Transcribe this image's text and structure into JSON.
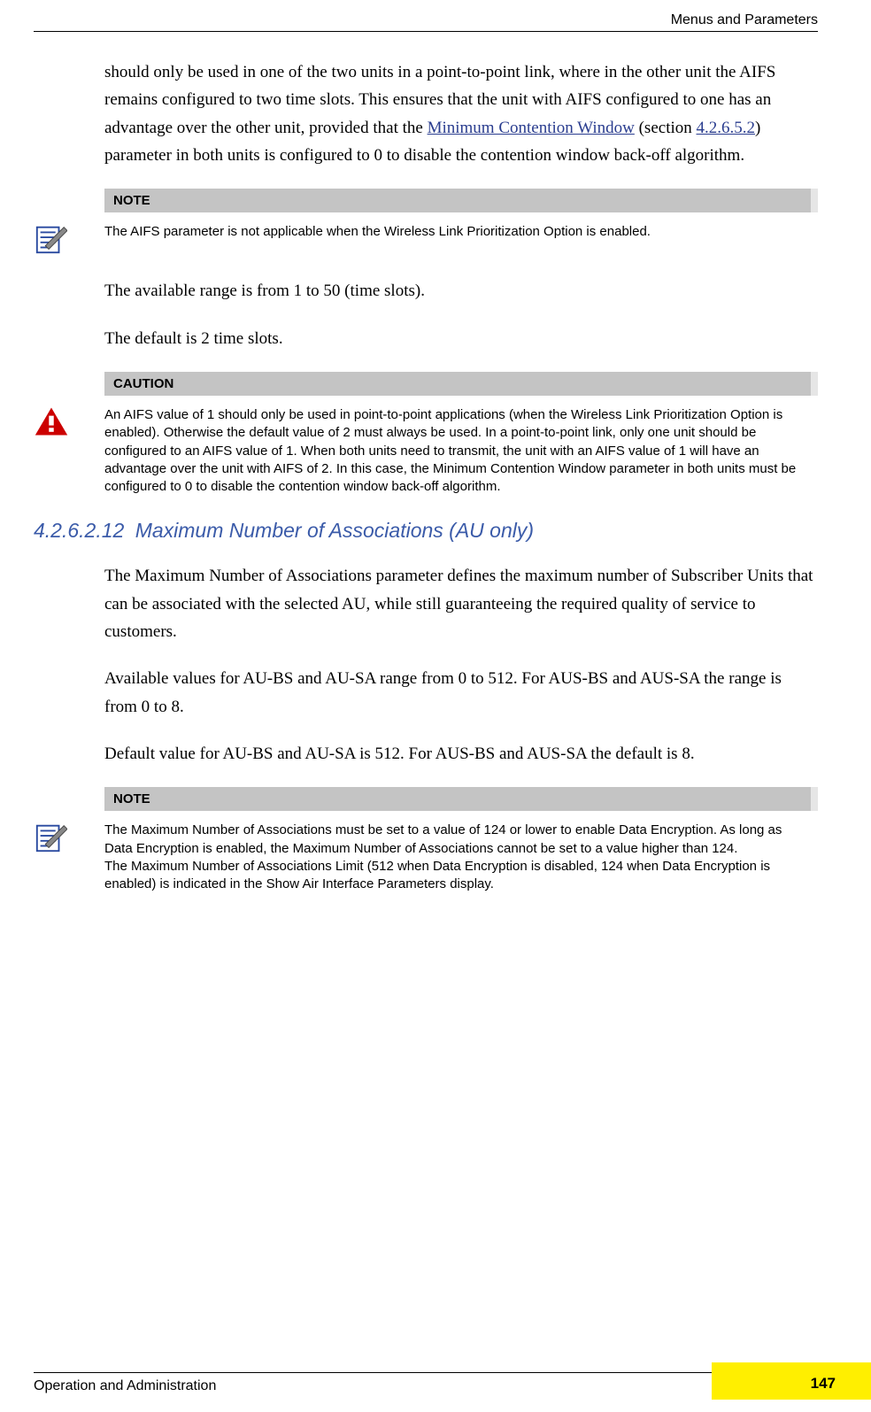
{
  "header": {
    "section": "Menus and Parameters"
  },
  "intro": {
    "para1_a": "should only be used in one of the two units in a point-to-point link, where in the other unit the AIFS remains configured to two time slots. This ensures that the unit with AIFS configured to one has an advantage over the other unit, provided that the ",
    "link1": "Minimum Contention Window",
    "para1_b": " (section ",
    "link2": "4.2.6.5.2",
    "para1_c": ") parameter in both units is configured to 0 to disable the contention window back-off algorithm."
  },
  "note1": {
    "header": "NOTE",
    "body": "The AIFS parameter is not applicable when the Wireless Link Prioritization Option is enabled."
  },
  "mid": {
    "p1": "The available range is from 1 to 50 (time slots).",
    "p2": "The default is 2 time slots."
  },
  "caution": {
    "header": "CAUTION",
    "body": "An AIFS value of 1 should only be used in point-to-point applications (when the Wireless Link Prioritization Option is enabled). Otherwise the default value of 2 must always be used. In a point-to-point link, only one unit should be configured to an AIFS value of 1. When both units need to transmit, the unit with an AIFS value of 1 will have an advantage over the unit with AIFS of 2. In this case, the Minimum Contention Window parameter in both units must be configured to 0 to disable the contention window back-off algorithm."
  },
  "section": {
    "num": "4.2.6.2.12",
    "title": "Maximum Number of Associations (AU only)"
  },
  "assoc": {
    "p1": "The Maximum Number of Associations parameter defines the maximum number of Subscriber Units that can be associated with the selected AU, while still guaranteeing the required quality of service to customers.",
    "p2": "Available values for AU-BS and AU-SA range from 0 to 512. For AUS-BS and AUS-SA the range is from 0 to 8.",
    "p3": "Default value for AU-BS and AU-SA is 512. For AUS-BS and AUS-SA the default is 8."
  },
  "note2": {
    "header": "NOTE",
    "body_l1": "The Maximum Number of Associations must be set to a value of 124 or lower to enable Data Encryption. As long as Data Encryption is enabled, the Maximum Number of Associations cannot be set to a value higher than 124.",
    "body_l2": "The Maximum Number of Associations Limit (512 when Data Encryption is disabled, 124 when Data Encryption is enabled) is indicated in the Show Air Interface Parameters display."
  },
  "footer": {
    "left": "Operation and Administration",
    "page": "147"
  }
}
